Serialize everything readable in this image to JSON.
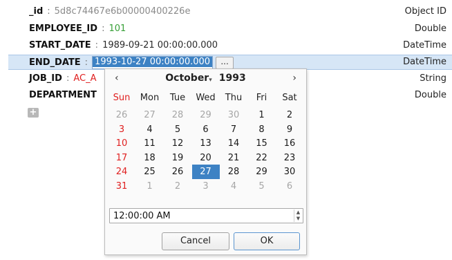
{
  "fields": [
    {
      "key": "_id",
      "value": "5d8c74467e6b00000400226e",
      "type": "Object ID",
      "value_style": "grey"
    },
    {
      "key": "EMPLOYEE_ID",
      "value": "101",
      "type": "Double",
      "value_style": "green"
    },
    {
      "key": "START_DATE",
      "value": "1989-09-21 00:00:00.000",
      "type": "DateTime",
      "value_style": "dark"
    },
    {
      "key": "END_DATE",
      "value": "1993-10-27 00:00:00.000",
      "type": "DateTime",
      "value_style": "editing"
    },
    {
      "key": "JOB_ID",
      "value": "AC_A",
      "type": "String",
      "value_style": "red"
    },
    {
      "key": "DEPARTMENT",
      "value": "",
      "type": "Double",
      "value_style": "dark"
    }
  ],
  "separator": ":",
  "ellipsis_label": "...",
  "add_label": "+",
  "calendar": {
    "prev": "‹",
    "next": "›",
    "month": "October",
    "year": "1993",
    "month_dropdown": "▾",
    "weekdays": [
      "Sun",
      "Mon",
      "Tue",
      "Wed",
      "Thu",
      "Fri",
      "Sat"
    ],
    "weeks": [
      [
        {
          "d": "26",
          "o": true
        },
        {
          "d": "27",
          "o": true
        },
        {
          "d": "28",
          "o": true
        },
        {
          "d": "29",
          "o": true
        },
        {
          "d": "30",
          "o": true
        },
        {
          "d": "1"
        },
        {
          "d": "2"
        }
      ],
      [
        {
          "d": "3"
        },
        {
          "d": "4"
        },
        {
          "d": "5"
        },
        {
          "d": "6"
        },
        {
          "d": "7"
        },
        {
          "d": "8"
        },
        {
          "d": "9"
        }
      ],
      [
        {
          "d": "10"
        },
        {
          "d": "11"
        },
        {
          "d": "12"
        },
        {
          "d": "13"
        },
        {
          "d": "14"
        },
        {
          "d": "15"
        },
        {
          "d": "16"
        }
      ],
      [
        {
          "d": "17"
        },
        {
          "d": "18"
        },
        {
          "d": "19"
        },
        {
          "d": "20"
        },
        {
          "d": "21"
        },
        {
          "d": "22"
        },
        {
          "d": "23"
        }
      ],
      [
        {
          "d": "24"
        },
        {
          "d": "25"
        },
        {
          "d": "26"
        },
        {
          "d": "27",
          "s": true
        },
        {
          "d": "28"
        },
        {
          "d": "29"
        },
        {
          "d": "30"
        }
      ],
      [
        {
          "d": "31"
        },
        {
          "d": "1",
          "o": true
        },
        {
          "d": "2",
          "o": true
        },
        {
          "d": "3",
          "o": true
        },
        {
          "d": "4",
          "o": true
        },
        {
          "d": "5",
          "o": true
        },
        {
          "d": "6",
          "o": true
        }
      ]
    ],
    "time_value": "12:00:00 AM",
    "spinner_up": "▲",
    "spinner_down": "▼",
    "cancel_label": "Cancel",
    "ok_label": "OK"
  },
  "colors": {
    "accent": "#3d82c4",
    "selected_row": "#d6e6f6",
    "sunday": "#e02020",
    "number": "#38a038",
    "string": "#e02020"
  }
}
